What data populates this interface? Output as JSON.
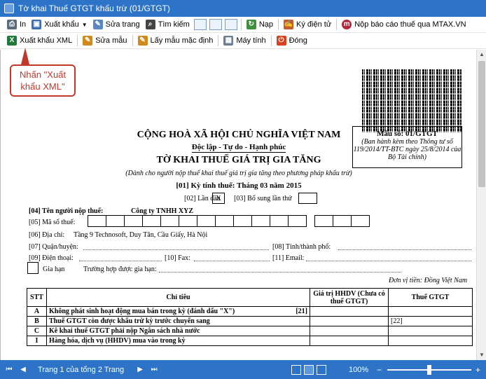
{
  "window": {
    "title": "Tờ khai Thuế GTGT khấu trừ (01/GTGT)"
  },
  "toolbar1": {
    "in": "In",
    "xuat_khau": "Xuất khẩu",
    "sua_trang": "Sửa trang",
    "tim_kiem": "Tìm kiếm",
    "nap": "Nạp",
    "ky_dien_tu": "Ký điện tử",
    "nop_bao_cao": "Nộp báo cáo thuế qua MTAX.VN"
  },
  "toolbar2": {
    "xuat_khau_xml": "Xuất khẩu XML",
    "sua_mau": "Sửa mẫu",
    "lay_mau": "Lấy mẫu mặc định",
    "may_tinh": "Máy tính",
    "dong": "Đóng"
  },
  "callout": {
    "text": "Nhấn \"Xuất khẩu XML\""
  },
  "document": {
    "nation": "CỘNG HOÀ XÃ HỘI CHỦ NGHĨA VIỆT NAM",
    "motto": "Độc lập - Tự do - Hạnh phúc",
    "title": "TỜ KHAI THUẾ GIÁ TRỊ GIA TĂNG",
    "subtitle": "(Dành cho người nộp thuế khai thuế giá trị gia tăng theo phương pháp khấu trừ)",
    "period_label": "[01] Kỳ tính thuế:",
    "period_value": "Tháng 03 năm 2015",
    "form_code": "Mẫu số: 01/GTGT",
    "form_note": "(Ban hành kèm theo Thông tư số 119/2014/TT-BTC ngày 25/8/2014 của Bộ Tài chính)",
    "first_time_label": "[02] Lần đầu",
    "first_time_value": "X",
    "supplement_label": "[03] Bổ sung lần thứ",
    "taxpayer_label": "[04] Tên người nộp thuế:",
    "taxpayer_value": "Công ty TNHH XYZ",
    "tax_code_label": "[05] Mã số thuế:",
    "address_label": "[06] Địa chỉ:",
    "address_value": "Tầng 9 Technosoft, Duy Tân, Cầu Giấy, Hà Nội",
    "district_label": "[07] Quận/huyện:",
    "province_label": "[08] Tỉnh/thành phố:",
    "phone_label": "[09] Điện thoại:",
    "fax_label": "[10] Fax:",
    "email_label": "[11] Email:",
    "extension_label": "Gia hạn",
    "extension_case_label": "Trường hợp được gia hạn:",
    "currency_note": "Đơn vị tiền: Đồng Việt Nam"
  },
  "table": {
    "headers": [
      "STT",
      "Chỉ tiêu",
      "Giá trị HHDV (Chưa có thuế GTGT)",
      "Thuế GTGT"
    ],
    "rows": [
      {
        "stt": "A",
        "desc": "Không phát sinh hoạt động mua bán trong kỳ (đánh dấu \"X\")",
        "code": "[21]"
      },
      {
        "stt": "B",
        "desc": "Thuế GTGT còn được khấu trừ kỳ trước chuyển sang",
        "code": "[22]"
      },
      {
        "stt": "C",
        "desc": "Kê khai thuế GTGT phải nộp Ngân sách nhà nước",
        "code": ""
      },
      {
        "stt": "I",
        "desc": "Hàng hóa, dịch vụ (HHDV) mua vào trong kỳ",
        "code": ""
      }
    ]
  },
  "statusbar": {
    "page_info": "Trang 1 của tổng 2 Trang",
    "zoom": "100%",
    "zoom_level": 0.5
  }
}
